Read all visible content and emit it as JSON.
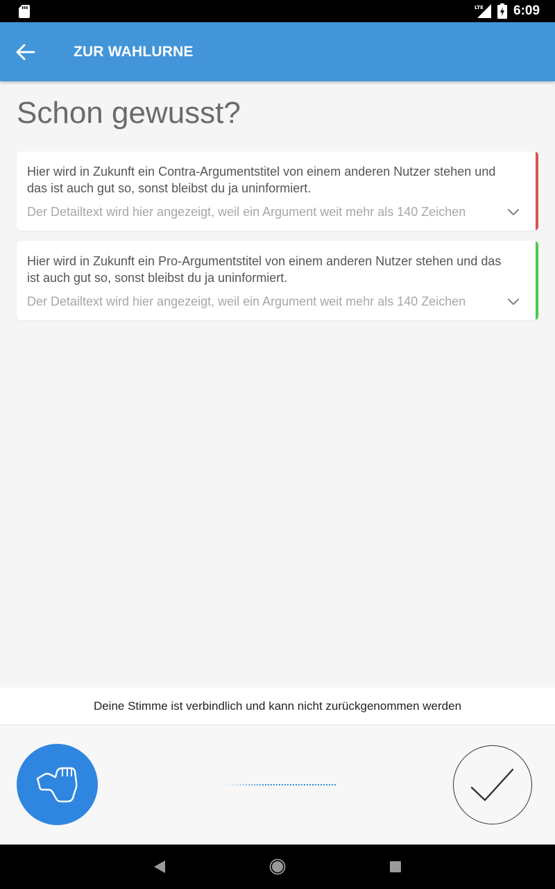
{
  "status_bar": {
    "time": "6:09",
    "network_label": "LTE",
    "icons": [
      "sd-card-icon",
      "lte-signal-icon",
      "battery-charging-icon"
    ]
  },
  "app_bar": {
    "back_icon": "arrow-left-icon",
    "title": "ZUR WAHLURNE",
    "color": "#4295d8"
  },
  "main": {
    "heading": "Schon gewusst?",
    "arguments": [
      {
        "kind": "contra",
        "title": "Hier wird in Zukunft ein Contra-Argumentstitel von einem anderen Nutzer stehen und das ist auch gut so, sonst bleibst du ja uninformiert.",
        "detail": "Der Detailtext wird hier angezeigt, weil ein Argument weit mehr als 140 Zeichen",
        "stripe_color": "#d9534f",
        "expand_icon": "chevron-down-icon"
      },
      {
        "kind": "pro",
        "title": "Hier wird in Zukunft ein Pro-Argumentstitel von einem anderen Nutzer stehen und das ist auch gut so, sonst bleibst du ja uninformiert.",
        "detail": "Der Detailtext wird hier angezeigt, weil ein Argument weit mehr als 140 Zeichen",
        "stripe_color": "#4cca4c",
        "expand_icon": "chevron-down-icon"
      }
    ]
  },
  "vote": {
    "notice": "Deine Stimme ist verbindlich und kann nicht zurückgenommen werden",
    "hand_icon": "thumbs-up-hand-icon",
    "confirm_icon": "checkmark-icon",
    "button_color": "#2f86e0"
  },
  "nav_bar": {
    "icons": [
      "nav-back-icon",
      "nav-home-icon",
      "nav-recents-icon"
    ]
  }
}
